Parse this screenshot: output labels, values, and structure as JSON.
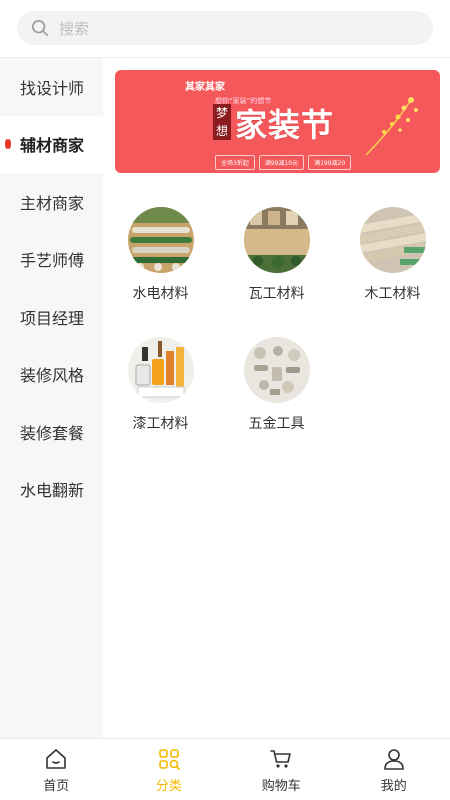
{
  "search": {
    "placeholder": "搜索"
  },
  "sidebar": {
    "items": [
      {
        "label": "找设计师",
        "active": false
      },
      {
        "label": "辅材商家",
        "active": true
      },
      {
        "label": "主材商家",
        "active": false
      },
      {
        "label": "手艺师傅",
        "active": false
      },
      {
        "label": "项目经理",
        "active": false
      },
      {
        "label": "装修风格",
        "active": false
      },
      {
        "label": "装修套餐",
        "active": false
      },
      {
        "label": "水电翻新",
        "active": false
      }
    ]
  },
  "banner": {
    "logo": "其家其家",
    "tagline": "想你“家装”的想节",
    "dream": "梦想",
    "title": "家装节",
    "coupons": [
      "全场3折起",
      "满99减10元",
      "满199减20"
    ],
    "bg_color": "#f4585b"
  },
  "categories": [
    {
      "label": "水电材料",
      "icon": "plumbing-materials-photo"
    },
    {
      "label": "瓦工材料",
      "icon": "tile-materials-photo"
    },
    {
      "label": "木工材料",
      "icon": "carpentry-materials-photo"
    },
    {
      "label": "漆工材料",
      "icon": "paint-materials-photo"
    },
    {
      "label": "五金工具",
      "icon": "hardware-tools-photo"
    }
  ],
  "tabbar": {
    "items": [
      {
        "label": "首页",
        "icon": "home-icon",
        "active": false
      },
      {
        "label": "分类",
        "icon": "category-icon",
        "active": true
      },
      {
        "label": "购物车",
        "icon": "cart-icon",
        "active": false
      },
      {
        "label": "我的",
        "icon": "user-icon",
        "active": false
      }
    ],
    "active_color": "#f5b800"
  }
}
